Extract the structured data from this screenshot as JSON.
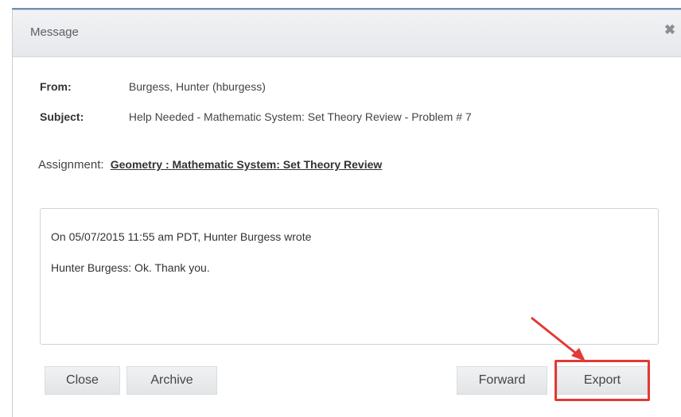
{
  "dialog": {
    "title": "Message",
    "close_glyph": "✖"
  },
  "message": {
    "from_label": "From:",
    "from_value": "Burgess, Hunter (hburgess)",
    "subject_label": "Subject:",
    "subject_value": "Help Needed - Mathematic System: Set Theory Review - Problem # 7",
    "assignment_label": "Assignment:",
    "assignment_link": "Geometry : Mathematic System: Set Theory Review",
    "body_line1": "On 05/07/2015 11:55 am PDT, Hunter Burgess wrote",
    "body_line2": "Hunter Burgess: Ok. Thank you."
  },
  "buttons": {
    "close": "Close",
    "archive": "Archive",
    "forward": "Forward",
    "export": "Export"
  },
  "annotation": {
    "highlight_color": "#e23a35",
    "arrow_color": "#e23a35"
  }
}
